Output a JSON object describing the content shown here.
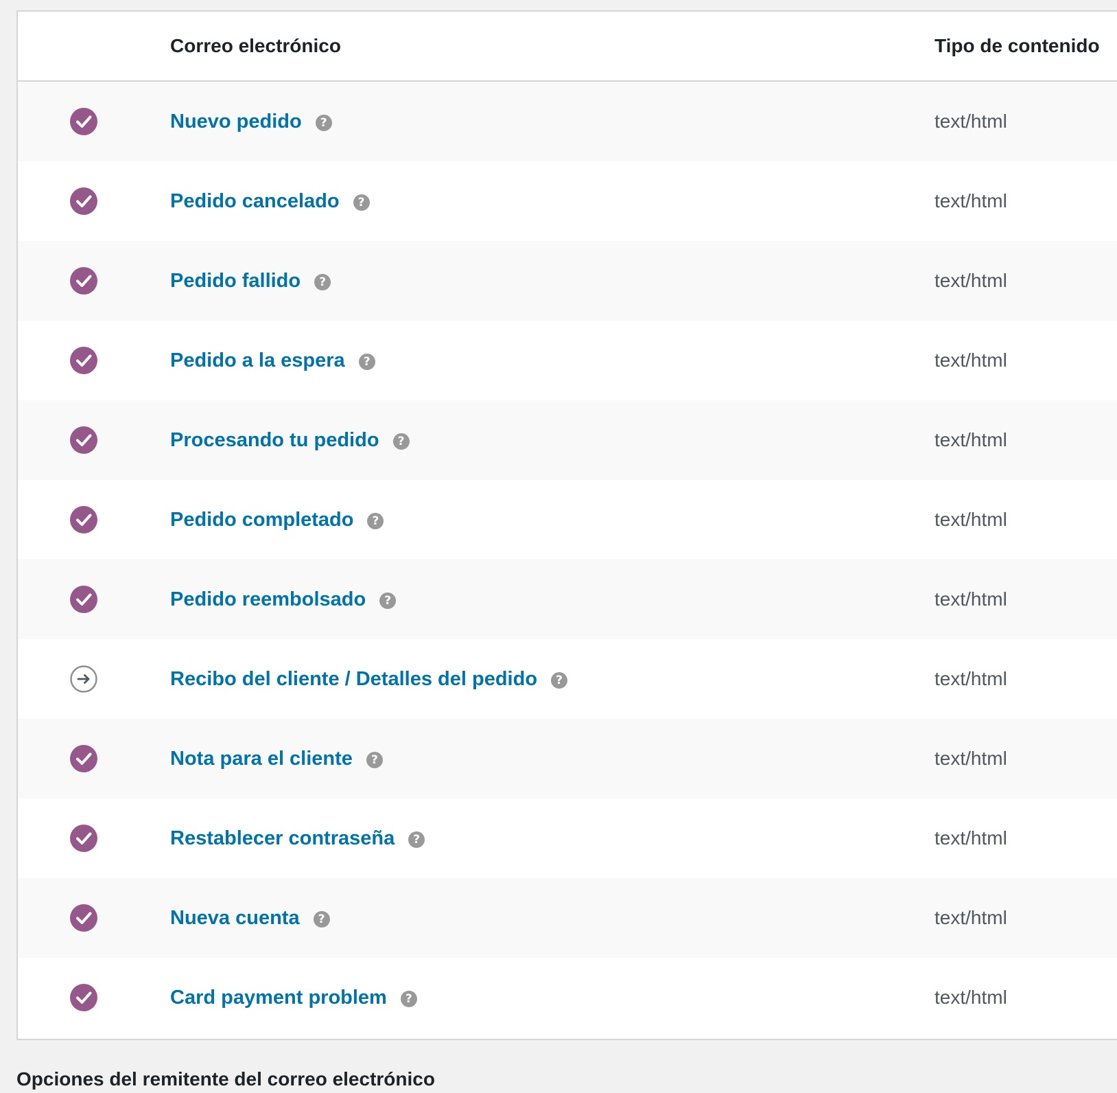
{
  "table": {
    "headers": {
      "email": "Correo electrónico",
      "content_type": "Tipo de contenido"
    },
    "rows": [
      {
        "title": "Nuevo pedido",
        "status": "enabled",
        "content_type": "text/html"
      },
      {
        "title": "Pedido cancelado",
        "status": "enabled",
        "content_type": "text/html"
      },
      {
        "title": "Pedido fallido",
        "status": "enabled",
        "content_type": "text/html"
      },
      {
        "title": "Pedido a la espera",
        "status": "enabled",
        "content_type": "text/html"
      },
      {
        "title": "Procesando tu pedido",
        "status": "enabled",
        "content_type": "text/html"
      },
      {
        "title": "Pedido completado",
        "status": "enabled",
        "content_type": "text/html"
      },
      {
        "title": "Pedido reembolsado",
        "status": "enabled",
        "content_type": "text/html"
      },
      {
        "title": "Recibo del cliente / Detalles del pedido",
        "status": "manual",
        "content_type": "text/html"
      },
      {
        "title": "Nota para el cliente",
        "status": "enabled",
        "content_type": "text/html"
      },
      {
        "title": "Restablecer contraseña",
        "status": "enabled",
        "content_type": "text/html"
      },
      {
        "title": "Nueva cuenta",
        "status": "enabled",
        "content_type": "text/html"
      },
      {
        "title": "Card payment problem",
        "status": "enabled",
        "content_type": "text/html"
      }
    ],
    "help_glyph": "?"
  },
  "icons": {
    "enabled": "check-circle-icon",
    "manual": "arrow-circle-icon",
    "help": "question-icon"
  },
  "colors": {
    "enabled_status": "#96588a",
    "link": "#0073aa",
    "help_icon": "#999999",
    "manual_status": "#8c8f94"
  },
  "below_table": {
    "heading": "Opciones del remitente del correo electrónico"
  }
}
